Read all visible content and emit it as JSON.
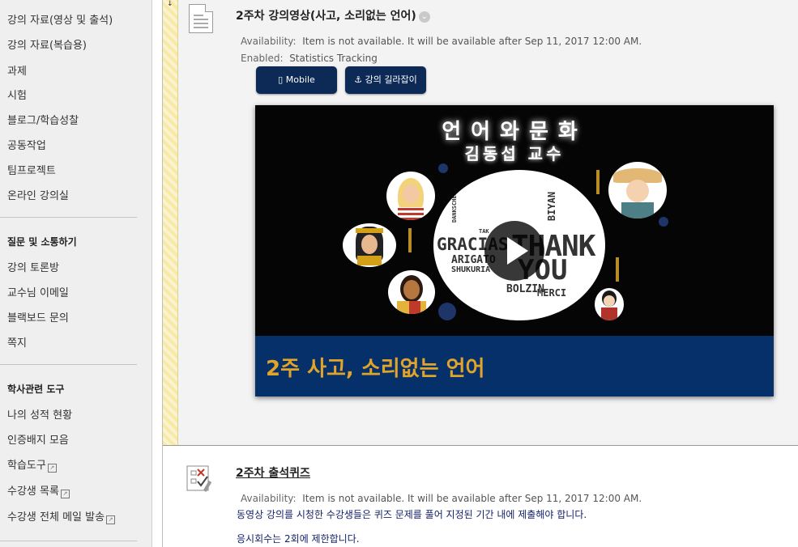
{
  "sidebar": {
    "items_top": [
      "강의 자료(영상 및 출석)",
      "강의 자료(복습용)",
      "과제",
      "시험",
      "블로그/학습성찰",
      "공동작업",
      "팀프로젝트",
      "온라인 강의실"
    ],
    "section2_header": "질문 및 소통하기",
    "items_section2": [
      "강의 토론방",
      "교수님 이메일",
      "블랙보드 문의",
      "쪽지"
    ],
    "section3_header": "학사관련 도구",
    "items_section3": [
      "나의 성적 현황",
      "인증배지 모음",
      "학습도구",
      "수강생 목록",
      "수강생 전체 메일 발송"
    ]
  },
  "item1": {
    "title": "2주차 강의영상(사고, 소리없는 언어)",
    "availability_label": "Availability:",
    "availability_text": "Item is not available. It will be available after Sep 11, 2017 12:00 AM.",
    "enabled_label": "Enabled:",
    "enabled_text": "Statistics Tracking",
    "mobile_button": "Mobile",
    "guide_button": "강의 길라잡이",
    "video": {
      "title_line1": "언어와문화",
      "title_line2": "김동섭 교수",
      "banner": "2주 사고, 소리없는 언어",
      "words": [
        "GRACIAS",
        "THANK",
        "YOU",
        "ARIGATO",
        "SHUKURIA",
        "BOLZIN",
        "MERCI",
        "BIYAN",
        "DANKSCHEEN",
        "TAK"
      ]
    }
  },
  "item2": {
    "title": "2주차 출석퀴즈",
    "availability_label": "Availability:",
    "availability_text": "Item is not available. It will be available after Sep 11, 2017 12:00 AM.",
    "desc1": "동영상 강의를 시청한 수강생들은 퀴즈 문제를 풀어 지정된 기간 내에 제출해야 합니다.",
    "desc2": "응시회수는 2회에 제한합니다."
  },
  "colors": {
    "button_bg": "#0d2a57",
    "banner_bg": "#05306a",
    "banner_text": "#e0a42a",
    "stripe": "#f7e9a6",
    "desc_text": "#14226a"
  },
  "icons": [
    "document-icon",
    "chevron-down-icon",
    "mobile-icon",
    "anchor-icon",
    "play-icon",
    "quiz-icon",
    "external-link-icon"
  ]
}
